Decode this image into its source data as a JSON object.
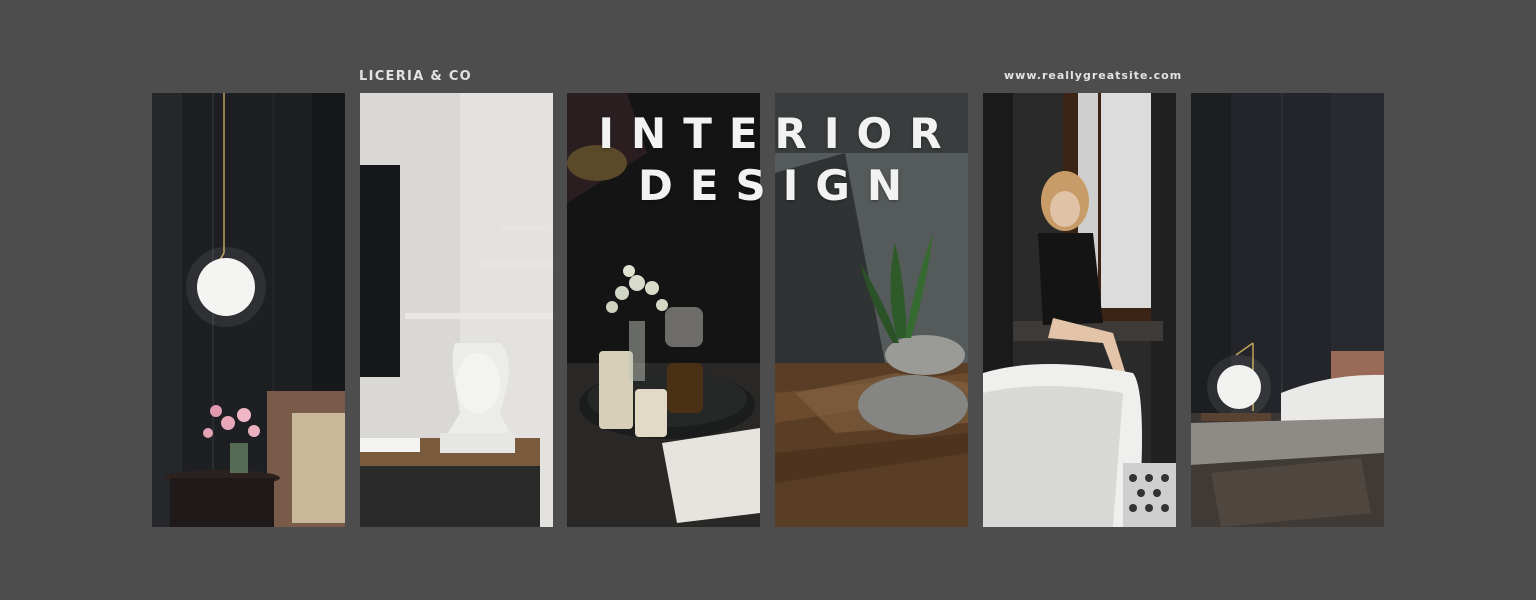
{
  "header": {
    "brand": "LICERIA & CO",
    "website": "www.reallygreatsite.com"
  },
  "headline": {
    "line1": "INTERIOR",
    "line2": "DESIGN"
  },
  "colors": {
    "background": "#4d4d4d",
    "text": "#f2f2f2"
  },
  "panels": [
    {
      "subject": "pendant-lamp-bedroom"
    },
    {
      "subject": "sculpture-bust-desk"
    },
    {
      "subject": "candles-tray-flowers"
    },
    {
      "subject": "stones-plant-wood-floor"
    },
    {
      "subject": "woman-window-bathtub"
    },
    {
      "subject": "bedside-lamp-bed"
    }
  ]
}
